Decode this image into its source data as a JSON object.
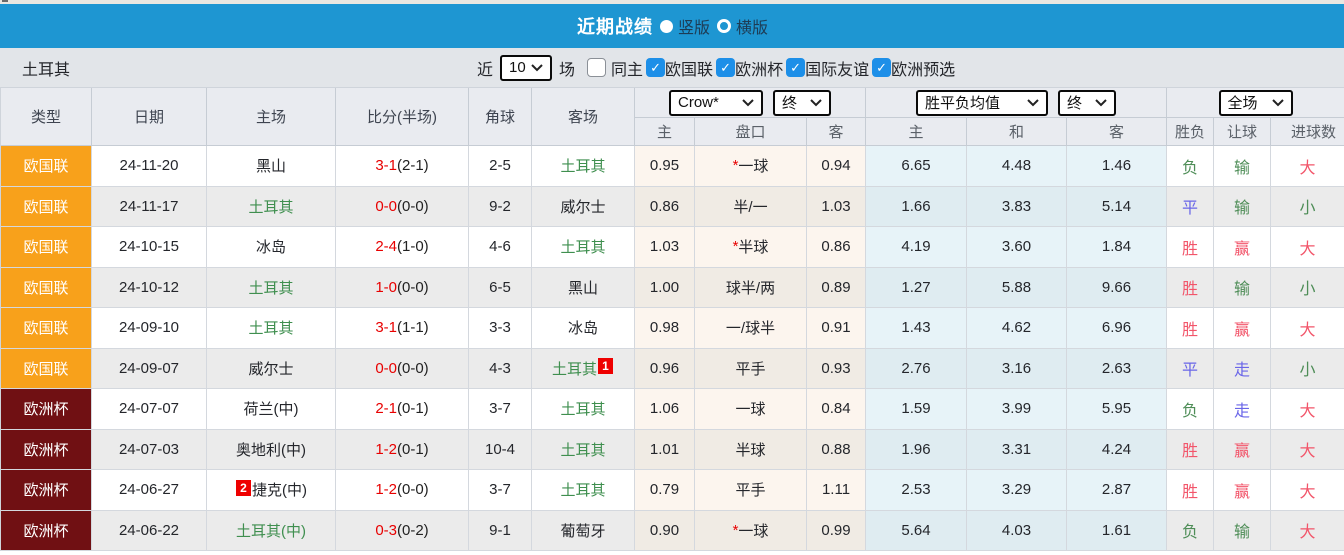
{
  "colors": {
    "accent_blue": "#1e96d2",
    "checkbox_blue": "#1d8fe8",
    "team_green": "#3f8f4f",
    "score_red": "#e80000",
    "star_red": "#e80000",
    "card_red": "#ee0000",
    "badge_nations_league": "#f8a11b",
    "badge_euro": "#701013",
    "result": {
      "red": "#f2556a",
      "green": "#4e8d57",
      "blue": "#6a66e8"
    }
  },
  "titlebar": {
    "title": "近期战绩",
    "options": [
      {
        "label": "竖版",
        "selected": true
      },
      {
        "label": "横版",
        "selected": false
      }
    ]
  },
  "filterbar": {
    "team": "土耳其",
    "recent_label": "近",
    "recent_value": "10",
    "matches_label": "场",
    "same_home": {
      "label": "同主",
      "checked": false
    },
    "competitions": [
      {
        "label": "欧国联",
        "checked": true
      },
      {
        "label": "欧洲杯",
        "checked": true
      },
      {
        "label": "国际友谊",
        "checked": true
      },
      {
        "label": "欧洲预选",
        "checked": true
      }
    ]
  },
  "table": {
    "headers": {
      "type": "类型",
      "date": "日期",
      "home": "主场",
      "score": "比分(半场)",
      "corner": "角球",
      "away": "客场"
    },
    "sub_headers": {
      "odds_home": "主",
      "handicap": "盘口",
      "odds_away": "客",
      "avg_home": "主",
      "avg_draw": "和",
      "avg_away": "客",
      "wdl": "胜负",
      "let_ball": "让球",
      "goals": "进球数"
    },
    "dropdowns": {
      "odds_source": "Crow*",
      "odds_state": "终",
      "avg_label": "胜平负均值",
      "avg_state": "终",
      "scope": "全场"
    },
    "rows": [
      {
        "competition": "欧国联",
        "competition_color": "#f8a11b",
        "date": "24-11-20",
        "home": {
          "name": "黑山",
          "green": false,
          "card": ""
        },
        "score": "3-1",
        "half": "(2-1)",
        "corner": "2-5",
        "away": {
          "name": "土耳其",
          "green": true,
          "card": ""
        },
        "odds": {
          "home": "0.95",
          "star": true,
          "handicap": "一球",
          "away": "0.94"
        },
        "avg": {
          "home": "6.65",
          "draw": "4.48",
          "away": "1.46"
        },
        "results": {
          "wdl": {
            "text": "负",
            "color": "green"
          },
          "handicap": {
            "text": "输",
            "color": "green"
          },
          "goals": {
            "text": "大",
            "color": "red"
          }
        }
      },
      {
        "competition": "欧国联",
        "competition_color": "#f8a11b",
        "date": "24-11-17",
        "home": {
          "name": "土耳其",
          "green": true,
          "card": ""
        },
        "score": "0-0",
        "half": "(0-0)",
        "corner": "9-2",
        "away": {
          "name": "威尔士",
          "green": false,
          "card": ""
        },
        "odds": {
          "home": "0.86",
          "star": false,
          "handicap": "半/一",
          "away": "1.03"
        },
        "avg": {
          "home": "1.66",
          "draw": "3.83",
          "away": "5.14"
        },
        "results": {
          "wdl": {
            "text": "平",
            "color": "blue"
          },
          "handicap": {
            "text": "输",
            "color": "green"
          },
          "goals": {
            "text": "小",
            "color": "green"
          }
        }
      },
      {
        "competition": "欧国联",
        "competition_color": "#f8a11b",
        "date": "24-10-15",
        "home": {
          "name": "冰岛",
          "green": false,
          "card": ""
        },
        "score": "2-4",
        "half": "(1-0)",
        "corner": "4-6",
        "away": {
          "name": "土耳其",
          "green": true,
          "card": ""
        },
        "odds": {
          "home": "1.03",
          "star": true,
          "handicap": "半球",
          "away": "0.86"
        },
        "avg": {
          "home": "4.19",
          "draw": "3.60",
          "away": "1.84"
        },
        "results": {
          "wdl": {
            "text": "胜",
            "color": "red"
          },
          "handicap": {
            "text": "赢",
            "color": "red"
          },
          "goals": {
            "text": "大",
            "color": "red"
          }
        }
      },
      {
        "competition": "欧国联",
        "competition_color": "#f8a11b",
        "date": "24-10-12",
        "home": {
          "name": "土耳其",
          "green": true,
          "card": ""
        },
        "score": "1-0",
        "half": "(0-0)",
        "corner": "6-5",
        "away": {
          "name": "黑山",
          "green": false,
          "card": ""
        },
        "odds": {
          "home": "1.00",
          "star": false,
          "handicap": "球半/两",
          "away": "0.89"
        },
        "avg": {
          "home": "1.27",
          "draw": "5.88",
          "away": "9.66"
        },
        "results": {
          "wdl": {
            "text": "胜",
            "color": "red"
          },
          "handicap": {
            "text": "输",
            "color": "green"
          },
          "goals": {
            "text": "小",
            "color": "green"
          }
        }
      },
      {
        "competition": "欧国联",
        "competition_color": "#f8a11b",
        "date": "24-09-10",
        "home": {
          "name": "土耳其",
          "green": true,
          "card": ""
        },
        "score": "3-1",
        "half": "(1-1)",
        "corner": "3-3",
        "away": {
          "name": "冰岛",
          "green": false,
          "card": ""
        },
        "odds": {
          "home": "0.98",
          "star": false,
          "handicap": "一/球半",
          "away": "0.91"
        },
        "avg": {
          "home": "1.43",
          "draw": "4.62",
          "away": "6.96"
        },
        "results": {
          "wdl": {
            "text": "胜",
            "color": "red"
          },
          "handicap": {
            "text": "赢",
            "color": "red"
          },
          "goals": {
            "text": "大",
            "color": "red"
          }
        }
      },
      {
        "competition": "欧国联",
        "competition_color": "#f8a11b",
        "date": "24-09-07",
        "home": {
          "name": "威尔士",
          "green": false,
          "card": ""
        },
        "score": "0-0",
        "half": "(0-0)",
        "corner": "4-3",
        "away": {
          "name": "土耳其",
          "green": true,
          "card": "1"
        },
        "odds": {
          "home": "0.96",
          "star": false,
          "handicap": "平手",
          "away": "0.93"
        },
        "avg": {
          "home": "2.76",
          "draw": "3.16",
          "away": "2.63"
        },
        "results": {
          "wdl": {
            "text": "平",
            "color": "blue"
          },
          "handicap": {
            "text": "走",
            "color": "blue"
          },
          "goals": {
            "text": "小",
            "color": "green"
          }
        }
      },
      {
        "competition": "欧洲杯",
        "competition_color": "#701013",
        "date": "24-07-07",
        "home": {
          "name": "荷兰(中)",
          "green": false,
          "card": ""
        },
        "score": "2-1",
        "half": "(0-1)",
        "corner": "3-7",
        "away": {
          "name": "土耳其",
          "green": true,
          "card": ""
        },
        "odds": {
          "home": "1.06",
          "star": false,
          "handicap": "一球",
          "away": "0.84"
        },
        "avg": {
          "home": "1.59",
          "draw": "3.99",
          "away": "5.95"
        },
        "results": {
          "wdl": {
            "text": "负",
            "color": "green"
          },
          "handicap": {
            "text": "走",
            "color": "blue"
          },
          "goals": {
            "text": "大",
            "color": "red"
          }
        }
      },
      {
        "competition": "欧洲杯",
        "competition_color": "#701013",
        "date": "24-07-03",
        "home": {
          "name": "奥地利(中)",
          "green": false,
          "card": ""
        },
        "score": "1-2",
        "half": "(0-1)",
        "corner": "10-4",
        "away": {
          "name": "土耳其",
          "green": true,
          "card": ""
        },
        "odds": {
          "home": "1.01",
          "star": false,
          "handicap": "半球",
          "away": "0.88"
        },
        "avg": {
          "home": "1.96",
          "draw": "3.31",
          "away": "4.24"
        },
        "results": {
          "wdl": {
            "text": "胜",
            "color": "red"
          },
          "handicap": {
            "text": "赢",
            "color": "red"
          },
          "goals": {
            "text": "大",
            "color": "red"
          }
        }
      },
      {
        "competition": "欧洲杯",
        "competition_color": "#701013",
        "date": "24-06-27",
        "home": {
          "name": "捷克(中)",
          "green": false,
          "card": "2"
        },
        "score": "1-2",
        "half": "(0-0)",
        "corner": "3-7",
        "away": {
          "name": "土耳其",
          "green": true,
          "card": ""
        },
        "odds": {
          "home": "0.79",
          "star": false,
          "handicap": "平手",
          "away": "1.11"
        },
        "avg": {
          "home": "2.53",
          "draw": "3.29",
          "away": "2.87"
        },
        "results": {
          "wdl": {
            "text": "胜",
            "color": "red"
          },
          "handicap": {
            "text": "赢",
            "color": "red"
          },
          "goals": {
            "text": "大",
            "color": "red"
          }
        }
      },
      {
        "competition": "欧洲杯",
        "competition_color": "#701013",
        "date": "24-06-22",
        "home": {
          "name": "土耳其(中)",
          "green": true,
          "card": ""
        },
        "score": "0-3",
        "half": "(0-2)",
        "corner": "9-1",
        "away": {
          "name": "葡萄牙",
          "green": false,
          "card": ""
        },
        "odds": {
          "home": "0.90",
          "star": true,
          "handicap": "一球",
          "away": "0.99"
        },
        "avg": {
          "home": "5.64",
          "draw": "4.03",
          "away": "1.61"
        },
        "results": {
          "wdl": {
            "text": "负",
            "color": "green"
          },
          "handicap": {
            "text": "输",
            "color": "green"
          },
          "goals": {
            "text": "大",
            "color": "red"
          }
        }
      }
    ]
  }
}
